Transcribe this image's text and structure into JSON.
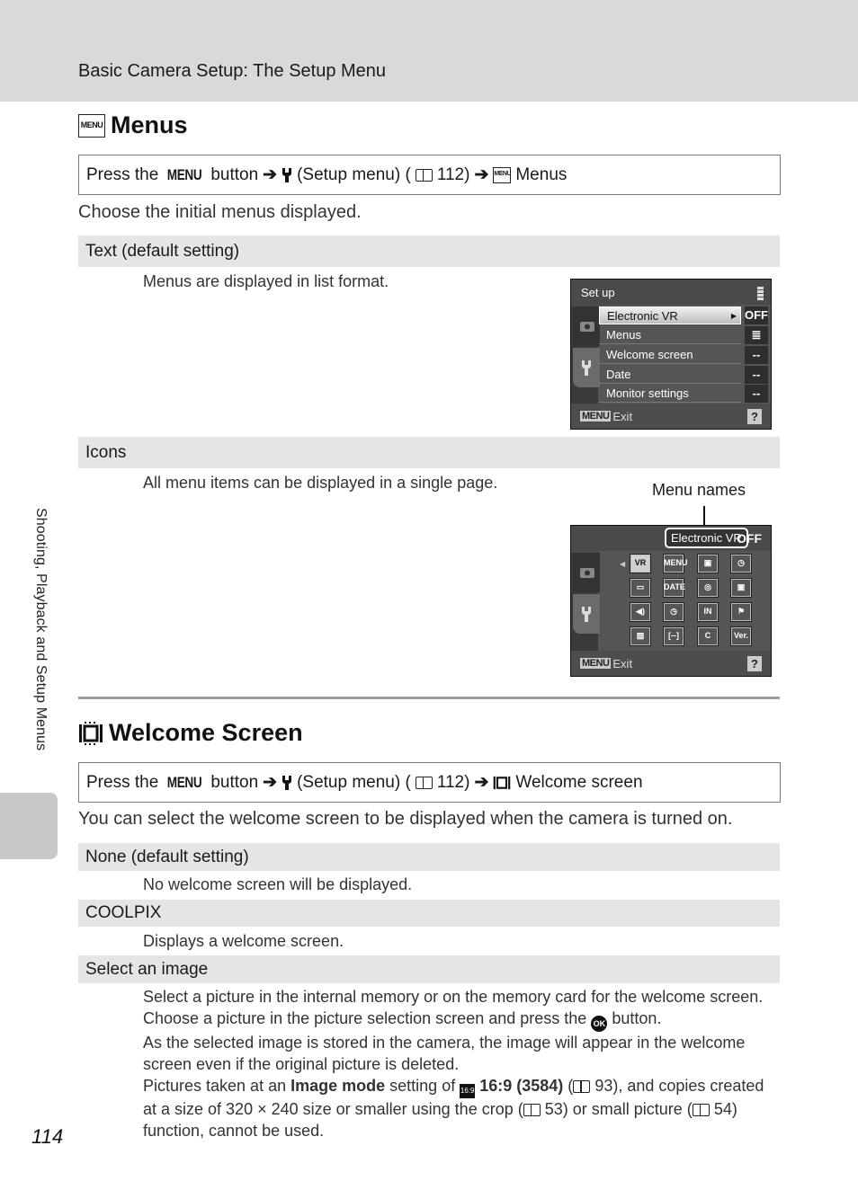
{
  "header": {
    "title": "Basic Camera Setup: The Setup Menu"
  },
  "side_label": "Shooting, Playback and Setup Menus",
  "page_number": "114",
  "menus_section": {
    "title": "Menus",
    "icon": "menu-setting-icon",
    "path": {
      "press": "Press the",
      "menu_word": "MENU",
      "button": "button",
      "arrow": "➔",
      "setup_text": "(Setup menu) (",
      "page_ref": "112)",
      "target": "Menus"
    },
    "intro": "Choose the initial menus displayed.",
    "options": [
      {
        "label": "Text (default setting)",
        "desc": "Menus are displayed in list format."
      },
      {
        "label": "Icons",
        "desc": "All menu items can be displayed in a single page."
      }
    ],
    "callout": "Menu names"
  },
  "list_screen": {
    "title": "Set up",
    "rows": [
      {
        "label": "Electronic VR",
        "value": "OFF",
        "selected": true
      },
      {
        "label": "Menus",
        "value": "≣",
        "selected": false
      },
      {
        "label": "Welcome screen",
        "value": "--",
        "selected": false
      },
      {
        "label": "Date",
        "value": "--",
        "selected": false
      },
      {
        "label": "Monitor settings",
        "value": "--",
        "selected": false
      }
    ],
    "footer_menu": "MENU",
    "footer_exit": "Exit",
    "help": "?"
  },
  "icon_screen": {
    "selected_name": "Electronic VR",
    "selected_value": "OFF",
    "icons": [
      [
        "VR",
        "MENU",
        "▣",
        "◷"
      ],
      [
        "▭",
        "DATE",
        "◎",
        "▣"
      ],
      [
        "◀)",
        "◷",
        "IN",
        "⚑"
      ],
      [
        "▨",
        "[--]",
        "C",
        "Ver."
      ]
    ],
    "footer_menu": "MENU",
    "footer_exit": "Exit",
    "help": "?"
  },
  "welcome_section": {
    "title": "Welcome Screen",
    "path": {
      "press": "Press the",
      "menu_word": "MENU",
      "button": "button",
      "arrow": "➔",
      "setup_text": "(Setup menu) (",
      "page_ref": "112)",
      "target": "Welcome screen"
    },
    "intro": "You can select the welcome screen to be displayed when the camera is turned on.",
    "options": [
      {
        "label": "None (default setting)",
        "desc": "No welcome screen will be displayed."
      },
      {
        "label": "COOLPIX",
        "desc": "Displays a welcome screen."
      },
      {
        "label": "Select an image"
      }
    ],
    "select_image_desc": {
      "line1": "Select a picture in the internal memory or on the memory card for the welcome screen. Choose a picture in the picture selection screen and press the",
      "ok": "OK",
      "line1_end": "button.",
      "line2": "As the selected image is stored in the camera, the image will appear in the welcome screen even if the original picture is deleted.",
      "line3_a": "Pictures taken at an",
      "image_mode": "Image mode",
      "line3_b": "setting of",
      "mode_value": "16:9 (3584)",
      "ref93": "93), and copies created at a size of 320 × 240 size or smaller using the crop (",
      "ref53": "53) or small picture (",
      "ref54": "54) function, cannot be used."
    }
  }
}
